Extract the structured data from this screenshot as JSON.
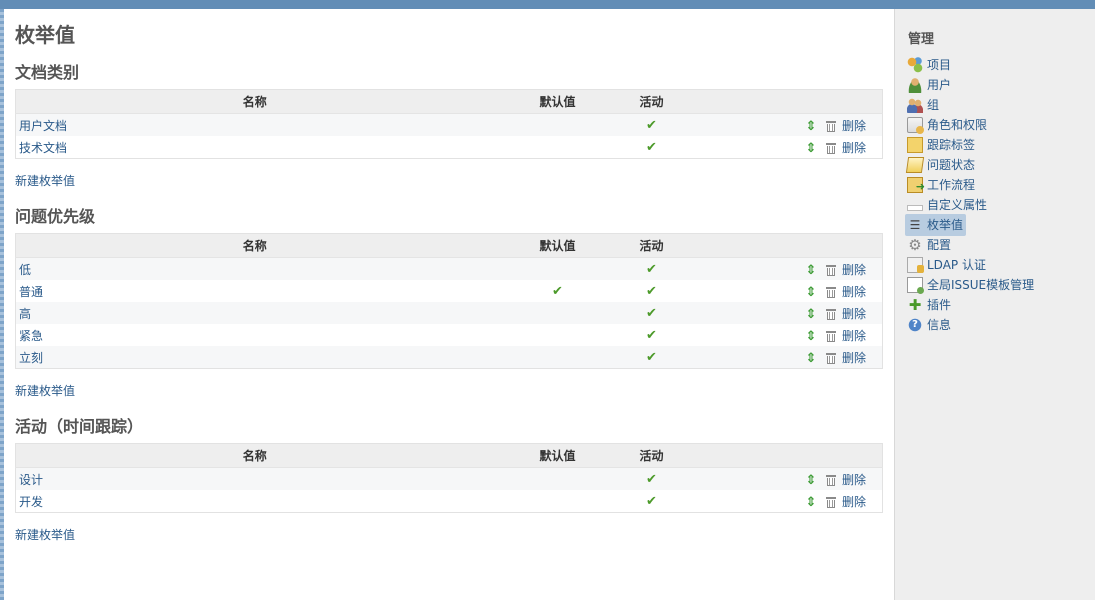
{
  "page_title": "枚举值",
  "columns": {
    "name": "名称",
    "default": "默认值",
    "active": "活动"
  },
  "actions": {
    "delete": "删除",
    "new": "新建枚举值"
  },
  "sections": [
    {
      "title": "文档类别",
      "rows": [
        {
          "name": "用户文档",
          "default": false,
          "active": true
        },
        {
          "name": "技术文档",
          "default": false,
          "active": true
        }
      ]
    },
    {
      "title": "问题优先级",
      "rows": [
        {
          "name": "低",
          "default": false,
          "active": true
        },
        {
          "name": "普通",
          "default": true,
          "active": true
        },
        {
          "name": "高",
          "default": false,
          "active": true
        },
        {
          "name": "紧急",
          "default": false,
          "active": true
        },
        {
          "name": "立刻",
          "default": false,
          "active": true
        }
      ]
    },
    {
      "title": "活动（时间跟踪）",
      "rows": [
        {
          "name": "设计",
          "default": false,
          "active": true
        },
        {
          "name": "开发",
          "default": false,
          "active": true
        }
      ]
    }
  ],
  "sidebar": {
    "title": "管理",
    "items": [
      {
        "label": "项目",
        "icon": "projects-icon"
      },
      {
        "label": "用户",
        "icon": "user-icon"
      },
      {
        "label": "组",
        "icon": "group-icon"
      },
      {
        "label": "角色和权限",
        "icon": "roles-icon"
      },
      {
        "label": "跟踪标签",
        "icon": "tracker-icon"
      },
      {
        "label": "问题状态",
        "icon": "issue-status-icon"
      },
      {
        "label": "工作流程",
        "icon": "workflow-icon"
      },
      {
        "label": "自定义属性",
        "icon": "custom-field-icon"
      },
      {
        "label": "枚举值",
        "icon": "enumeration-icon",
        "selected": true
      },
      {
        "label": "配置",
        "icon": "gear-icon"
      },
      {
        "label": "LDAP 认证",
        "icon": "ldap-icon"
      },
      {
        "label": "全局ISSUE模板管理",
        "icon": "template-icon"
      },
      {
        "label": "插件",
        "icon": "plugin-icon"
      },
      {
        "label": "信息",
        "icon": "info-icon"
      }
    ]
  },
  "colors": {
    "topbar": "#628db6",
    "link": "#2a5a8a",
    "check": "#4c9a2a",
    "sidebar_bg": "#eeeeee"
  }
}
